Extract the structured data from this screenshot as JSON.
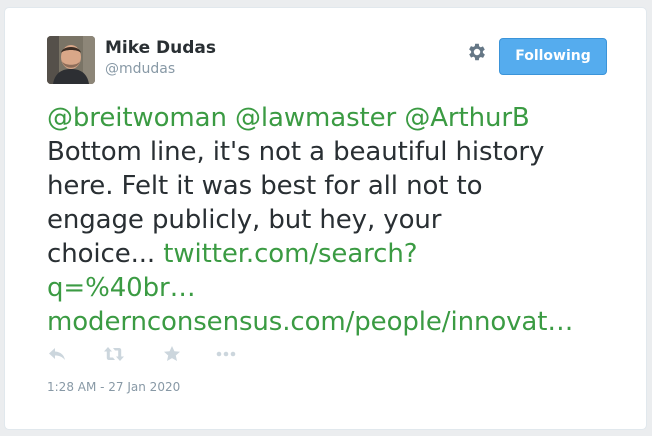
{
  "tweet": {
    "author": {
      "name": "Mike Dudas",
      "handle": "@mdudas",
      "avatar_icon": "profile-photo"
    },
    "follow_button": {
      "label": "Following",
      "color": "#55acee"
    },
    "settings_icon": "gear-icon",
    "mentions": [
      "@breitwoman",
      "@lawmaster",
      "@ArthurB"
    ],
    "text_lines": [
      "Bottom line, it's not a beautiful history",
      "here. Felt it was best for all not to",
      "engage publicly, but hey, your",
      "choice..."
    ],
    "links": [
      "twitter.com/search?",
      "q=%40br…",
      "modernconsensus.com/people/innovat…"
    ],
    "link_color": "#3b9b43",
    "actions": [
      "reply-icon",
      "retweet-icon",
      "favorite-icon",
      "more-icon"
    ],
    "timestamp": "1:28 AM - 27 Jan 2020"
  }
}
